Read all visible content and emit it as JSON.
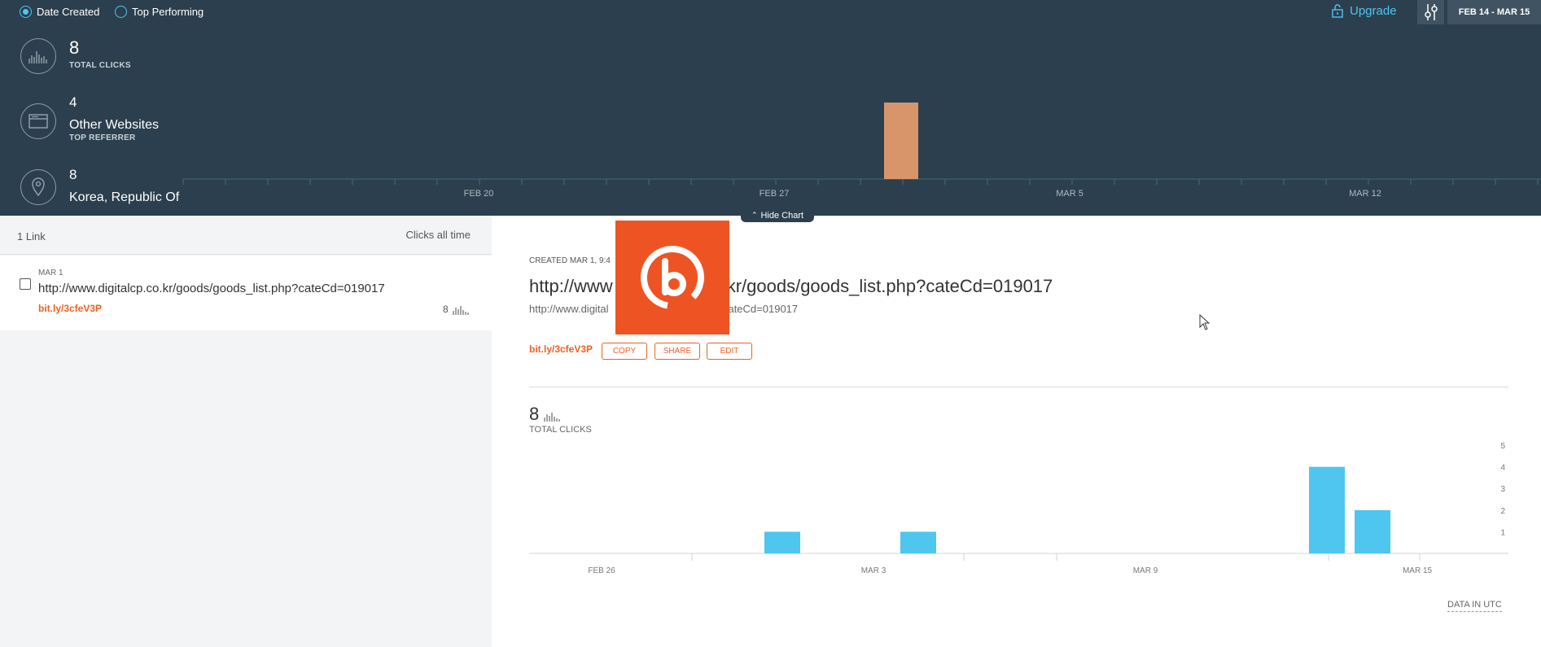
{
  "filters": {
    "date_created": "Date Created",
    "top_performing": "Top Performing",
    "selected": "date_created"
  },
  "header": {
    "upgrade": "Upgrade",
    "date_range": "FEB 14 - MAR 15"
  },
  "stats": {
    "total_clicks": {
      "value": "8",
      "label": "TOTAL CLICKS"
    },
    "top_referrer": {
      "value": "4",
      "label": "Other Websites",
      "sublabel": "TOP REFERRER"
    },
    "top_location": {
      "value": "8",
      "label": "Korea, Republic Of"
    }
  },
  "top_chart": {
    "x_ticks": [
      "FEB 20",
      "FEB 27",
      "MAR 5",
      "MAR 12"
    ],
    "hide_label": "Hide Chart",
    "bar_color": "#d9956a"
  },
  "list": {
    "count_label": "1 Link",
    "sort_label": "Clicks all time",
    "items": [
      {
        "date": "MAR 1",
        "url": "http://www.digitalcp.co.kr/goods/goods_list.php?cateCd=019017",
        "short": "bit.ly/3cfeV3P",
        "clicks": "8"
      }
    ]
  },
  "detail": {
    "created": "CREATED MAR 1, 9:4",
    "title_start": "http://www",
    "title_end": "kr/goods/goods_list.php?cateCd=019017",
    "long_url_start": "http://www.digital",
    "long_url_end": "list.php?cateCd=019017",
    "short": "bit.ly/3cfeV3P",
    "actions": {
      "copy": "COPY",
      "share": "SHARE",
      "edit": "EDIT"
    },
    "total_clicks": "8",
    "total_label": "TOTAL CLICKS",
    "utc_label": "DATA IN UTC"
  },
  "chart_data": [
    {
      "type": "bar",
      "x": [
        "2021-03-02"
      ],
      "values": [
        8
      ],
      "x_ticks": [
        "FEB 20",
        "FEB 27",
        "MAR 5",
        "MAR 12"
      ],
      "color": "#d9956a",
      "grid": false
    },
    {
      "type": "bar",
      "categories": [
        "FEB 28",
        "MAR 3",
        "MAR 13",
        "MAR 14"
      ],
      "values": [
        1,
        1,
        4,
        2
      ],
      "x_ticks": [
        "FEB 26",
        "MAR 3",
        "MAR 9",
        "MAR 15"
      ],
      "y_ticks": [
        "5",
        "4",
        "3",
        "2",
        "1"
      ],
      "ylim": [
        0,
        5
      ],
      "color": "#4ec6f0",
      "grid": false
    }
  ],
  "icons": {
    "brand": "bitly-logo",
    "lock": "lock-icon",
    "filter": "filter-sliders-icon"
  },
  "colors": {
    "accent": "#ee6123",
    "top_panel": "#2b3f4e",
    "link_blue": "#4ec6f0"
  }
}
